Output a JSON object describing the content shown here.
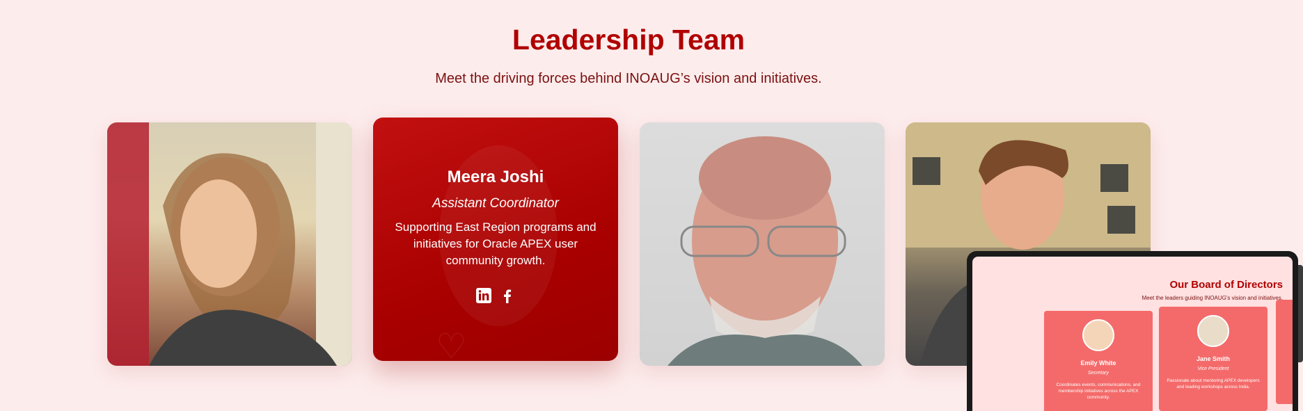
{
  "section": {
    "title": "Leadership Team",
    "subtitle": "Meet the driving forces behind INOAUG’s vision and initiatives."
  },
  "featured_member": {
    "name": "Meera Joshi",
    "role": "Assistant Coordinator",
    "description": "Supporting East Region programs and initiatives for Oracle APEX user community growth.",
    "socials": [
      "linkedin-icon",
      "facebook-icon"
    ]
  },
  "colors": {
    "background": "#fdecec",
    "accent": "#b00000",
    "card_red": "#a90000",
    "board_card": "#f46a6a"
  },
  "board_preview": {
    "title": "Our Board of Directors",
    "subtitle": "Meet the leaders guiding INOAUG's vision and initiatives.",
    "members": [
      {
        "name": "Emily White",
        "role": "Secretary",
        "description": "Coordinates events, communications, and membership initiatives across the APEX community."
      },
      {
        "name": "Jane Smith",
        "role": "Vice President",
        "description": "Passionate about mentoring APEX developers and leading workshops across India."
      }
    ]
  }
}
